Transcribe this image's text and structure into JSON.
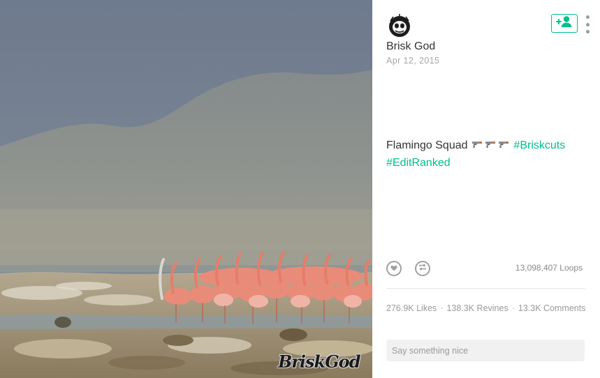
{
  "post": {
    "author": "Brisk God",
    "date": "Apr 12, 2015",
    "caption": {
      "text": "Flamingo Squad",
      "emojis": [
        "pistol-emoji",
        "pistol-emoji",
        "pistol-emoji"
      ],
      "hashtags": [
        "#Briskcuts",
        "#EditRanked"
      ]
    }
  },
  "video": {
    "watermark": "BriskGod"
  },
  "stats": {
    "loops": "13,098,407 Loops",
    "likes": "276.9K Likes",
    "revines": "138.3K Revines",
    "comments": "13.3K Comments",
    "separator": "·"
  },
  "comment_box": {
    "placeholder": "Say something nice"
  },
  "icons": {
    "follow": "add-user-icon",
    "more": "more-vertical-icon",
    "like": "heart-icon",
    "revine": "revine-icon"
  },
  "colors": {
    "accent": "#00bf8f",
    "text": "#333333",
    "muted": "#a6a6a6"
  }
}
